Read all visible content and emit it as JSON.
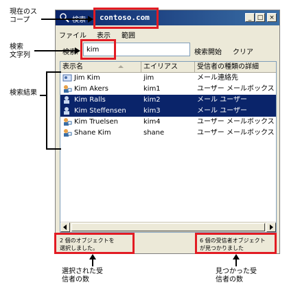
{
  "window": {
    "title_prefix": "検索",
    "scope": "contoso.com",
    "buttons": {
      "minimize": "_",
      "maximize": "□",
      "close": "×"
    }
  },
  "menu": [
    "ファイル",
    "表示",
    "範囲"
  ],
  "search": {
    "label": "検索:",
    "value": "kim",
    "start": "検索開始",
    "clear": "クリア"
  },
  "columns": [
    "表示名",
    "エイリアス",
    "受信者の種類の詳細"
  ],
  "rows": [
    {
      "name": "Jim Kim",
      "alias": "jim",
      "type": "メール連絡先",
      "icon": "contact-icon",
      "selected": false
    },
    {
      "name": "Kim Akers",
      "alias": "kim1",
      "type": "ユーザー メールボックス",
      "icon": "mailbox-user-icon",
      "selected": false
    },
    {
      "name": "Kim Ralls",
      "alias": "kim2",
      "type": "メール ユーザー",
      "icon": "mail-user-icon",
      "selected": true
    },
    {
      "name": "Kim Steffensen",
      "alias": "kim3",
      "type": "メール ユーザー",
      "icon": "mail-user-icon",
      "selected": true
    },
    {
      "name": "Kim Truelsen",
      "alias": "kim4",
      "type": "ユーザー メールボックス",
      "icon": "mailbox-user-icon",
      "selected": false
    },
    {
      "name": "Shane Kim",
      "alias": "shane",
      "type": "ユーザー メールボックス",
      "icon": "mailbox-user-icon",
      "selected": false
    }
  ],
  "status": {
    "left_line1": "2 個のオブジェクトを",
    "left_line2": "選択しました。",
    "right_line1": "6 個の受信者オブジェクト",
    "right_line2": "が見つかりました"
  },
  "callouts": {
    "scope_line1": "現在のス",
    "scope_line2": "コープ",
    "search_line1": "検索",
    "search_line2": "文字列",
    "results": "検索結果",
    "selected_line1": "選択された受",
    "selected_line2": "信者の数",
    "found_line1": "見つかった受",
    "found_line2": "信者の数"
  },
  "colors": {
    "highlight": "#e21b23",
    "selection": "#0a246a",
    "titlebar": "#0a246a"
  }
}
